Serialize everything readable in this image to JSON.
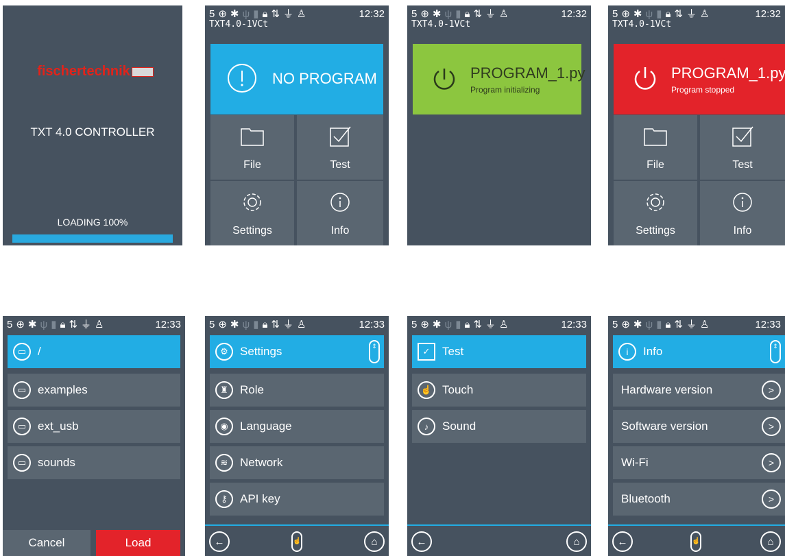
{
  "status": {
    "signal": "5",
    "icons": [
      "globe-icon",
      "bluetooth-icon",
      "usb-icon",
      "battery-icon",
      "lock-icon",
      "sync-icon",
      "power-plug-icon",
      "user-icon"
    ]
  },
  "splash": {
    "logo_a": "fischer",
    "logo_b": "technik",
    "title": "TXT 4.0 CONTROLLER",
    "loading": "LOADING 100%",
    "progress": 100
  },
  "home_no_program": {
    "time": "12:32",
    "device": "TXT4.0-1VCt",
    "banner": "NO PROGRAM",
    "tiles": [
      "File",
      "Test",
      "Settings",
      "Info"
    ]
  },
  "home_init": {
    "time": "12:32",
    "device": "TXT4.0-1VCt",
    "banner": "PROGRAM_1.py",
    "sub": "Program initializing"
  },
  "home_stopped": {
    "time": "12:32",
    "device": "TXT4.0-1VCt",
    "banner": "PROGRAM_1.py",
    "sub": "Program stopped",
    "tiles": [
      "File",
      "Test",
      "Settings",
      "Info"
    ]
  },
  "files": {
    "time": "12:33",
    "path": "/",
    "items": [
      "examples",
      "ext_usb",
      "sounds"
    ],
    "cancel": "Cancel",
    "load": "Load"
  },
  "settings": {
    "time": "12:33",
    "title": "Settings",
    "items": [
      "Role",
      "Language",
      "Network",
      "API key"
    ]
  },
  "test": {
    "time": "12:33",
    "title": "Test",
    "items": [
      "Touch",
      "Sound"
    ]
  },
  "info": {
    "time": "12:33",
    "title": "Info",
    "items": [
      "Hardware version",
      "Software version",
      "Wi-Fi",
      "Bluetooth"
    ]
  },
  "colors": {
    "background": "#46525f",
    "tile": "#5a6671",
    "accent": "#22ade4",
    "green": "#8cc63f",
    "red": "#e3232a"
  }
}
